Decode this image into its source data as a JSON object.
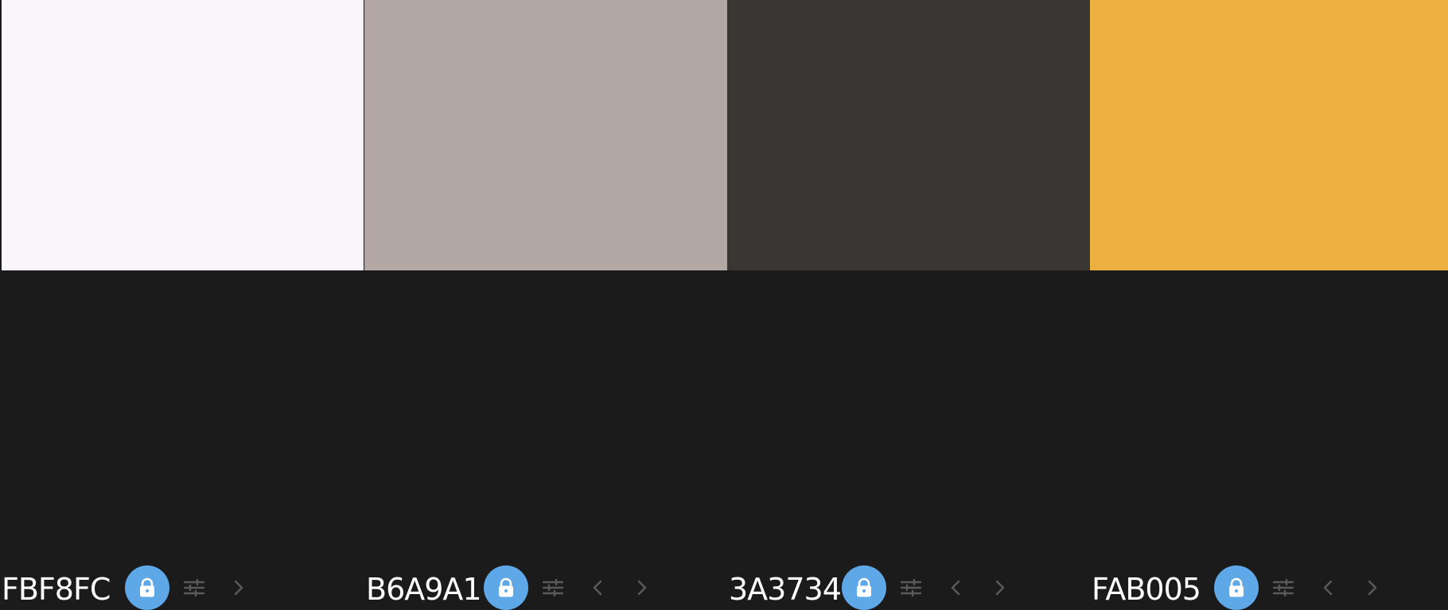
{
  "colors": {
    "accent": "#5ea8e8",
    "bar_background": "#1b1b1b",
    "icon_muted": "#5a5a5a",
    "hex_text": "#ffffff"
  },
  "palette": [
    {
      "hex": "FBF8FC",
      "swatch_color": "#f8f6fb"
    },
    {
      "hex": "B6A9A1",
      "swatch_color": "#b3a8a3"
    },
    {
      "hex": "3A3734",
      "swatch_color": "#383734"
    },
    {
      "hex": "FAB005",
      "swatch_color": "#edb040"
    }
  ],
  "icons": {
    "lock": "lock-icon",
    "adjust": "sliders-icon",
    "move_left": "chevron-left-icon",
    "move_right": "chevron-right-icon"
  }
}
